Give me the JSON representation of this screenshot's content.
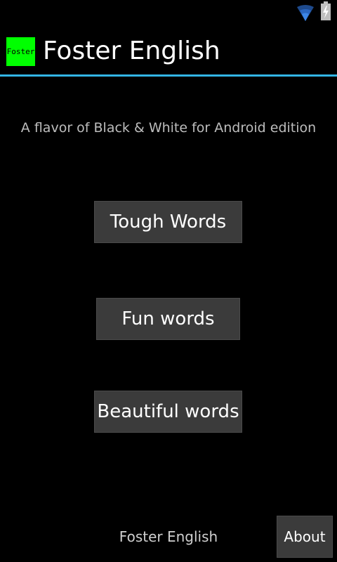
{
  "status_bar": {
    "icons": [
      "wifi-icon",
      "battery-charging-icon"
    ]
  },
  "action_bar": {
    "app_icon_text": "Foster",
    "app_icon_color": "#00ff00",
    "title": "Foster English",
    "divider_color": "#33b5e5"
  },
  "main": {
    "subtitle": "A flavor of Black & White for Android edition",
    "buttons": [
      {
        "label": "Tough Words"
      },
      {
        "label": "Fun words"
      },
      {
        "label": "Beautiful words"
      }
    ]
  },
  "footer": {
    "label": "Foster English",
    "about_label": "About"
  }
}
